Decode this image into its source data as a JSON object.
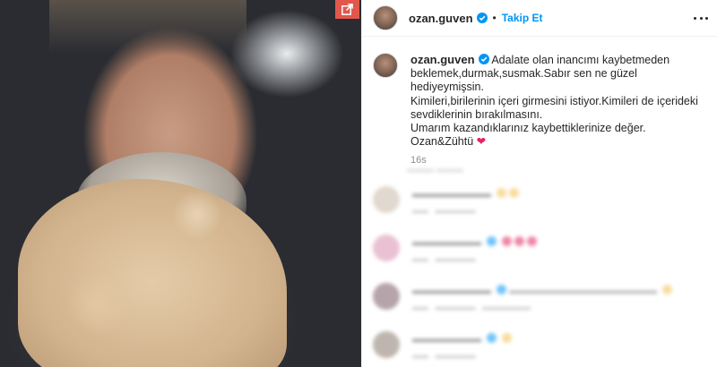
{
  "photo": {
    "alt_icon": "share-external-icon"
  },
  "header": {
    "username": "ozan.guven",
    "separator": "•",
    "follow_label": "Takip Et",
    "more_icon": "more-options-icon"
  },
  "caption": {
    "username": "ozan.guven",
    "text": "Adalate olan inancımı kaybetmeden beklemek,durmak,susmak.Sabır sen ne güzel hediyeymişsin.\nKimileri,birilerinin içeri girmesini istiyor.Kimileri de içerideki sevdiklerinin bırakılmasını.\nUmarım kazandıklarınız kaybettiklerinize değer.\nOzan&Zühtü",
    "heart": "❤",
    "time": "16s"
  },
  "colors": {
    "accent": "#0095f6",
    "verified": "#0095f6",
    "share_button": "#e2574c",
    "heart": "#e2255e"
  }
}
